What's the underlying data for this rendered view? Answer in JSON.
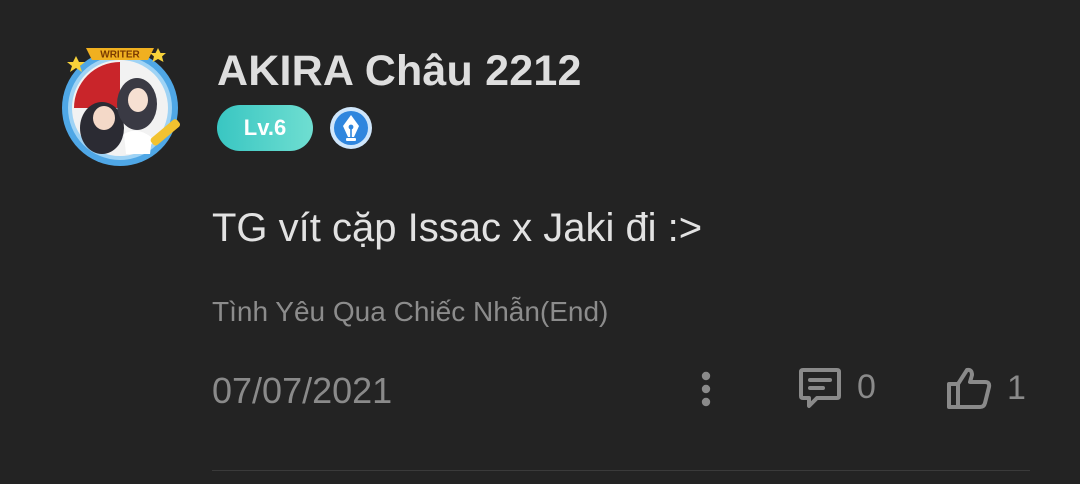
{
  "user": {
    "name": "AKIRA Châu 2212",
    "avatar_badge_text": "WRITER",
    "level": "Lv.6"
  },
  "comment": {
    "text": "TG vít cặp Issac x Jaki đi :>",
    "story_title": "Tình Yêu Qua Chiếc Nhẫn(End)",
    "date": "07/07/2021",
    "reply_count": "0",
    "like_count": "1"
  },
  "icons": {
    "more": "more-vertical-icon",
    "reply": "comment-icon",
    "like": "thumbs-up-icon",
    "writer": "fountain-pen-icon"
  },
  "colors": {
    "background": "#232323",
    "level_badge": "#39c6c2",
    "writer_badge": "#3b8fe0",
    "muted_text": "#8a8a8a"
  }
}
